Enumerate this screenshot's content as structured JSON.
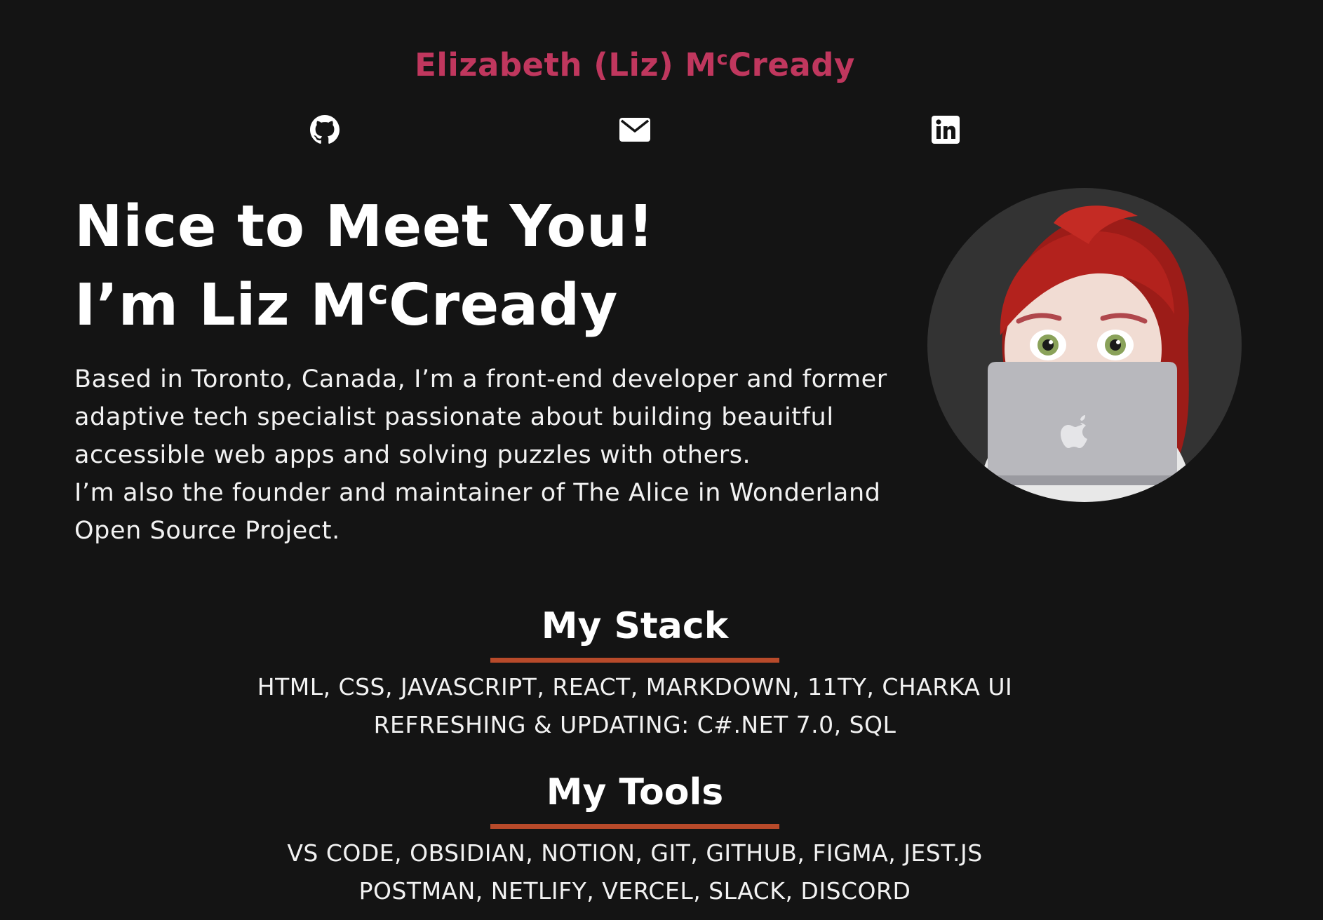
{
  "header": {
    "site_name_before": "Elizabeth (Liz) M",
    "site_name_sup": "c",
    "site_name_after": "Cready"
  },
  "social": [
    {
      "icon": "github-icon"
    },
    {
      "icon": "mail-icon"
    },
    {
      "icon": "linkedin-icon"
    }
  ],
  "hero": {
    "line1": "Nice to Meet You!",
    "line2_before": "I’m Liz M",
    "line2_sup": "c",
    "line2_after": "Cready",
    "bio_1": "Based in Toronto, Canada, I’m a front-end developer and former adaptive tech specialist passionate about building beauitful accessible web apps and solving puzzles with others.",
    "bio_2": "I’m also the founder and maintainer of The Alice in Wonderland Open Source Project."
  },
  "stack": {
    "title": "My Stack",
    "lines": [
      "HTML, CSS, JAVASCRIPT, REACT, MARKDOWN, 11TY, CHARKA UI",
      "REFRESHING & UPDATING: C#.NET 7.0, SQL"
    ]
  },
  "tools": {
    "title": "My Tools",
    "lines": [
      "VS CODE, OBSIDIAN, NOTION, GIT, GITHUB, FIGMA, JEST.JS",
      "POSTMAN, NETLIFY, VERCEL, SLACK, DISCORD"
    ]
  },
  "colors": {
    "background": "#141414",
    "accent_name": "#c0375e",
    "accent_rule": "#b84a2a",
    "text": "#ffffff"
  }
}
